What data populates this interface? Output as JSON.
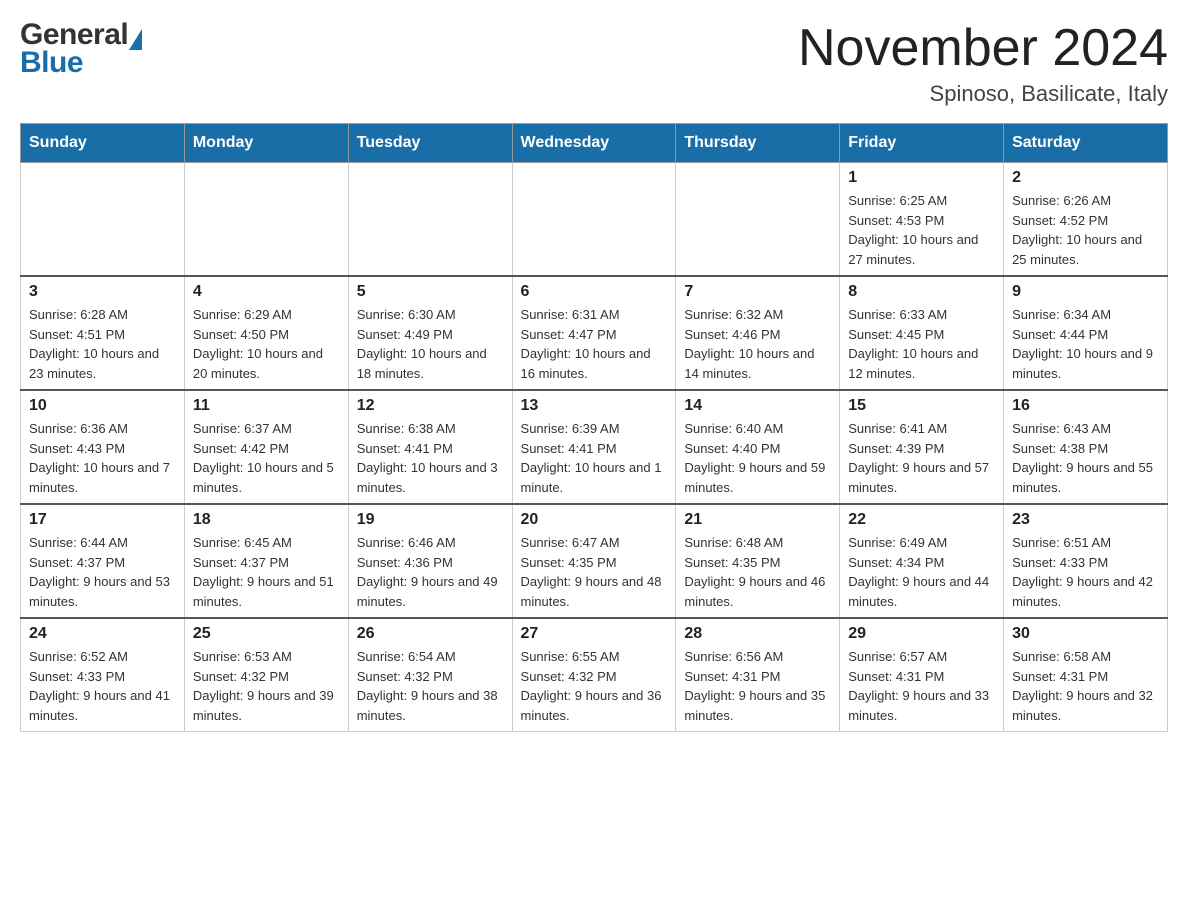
{
  "header": {
    "month_title": "November 2024",
    "subtitle": "Spinoso, Basilicate, Italy"
  },
  "days_of_week": [
    "Sunday",
    "Monday",
    "Tuesday",
    "Wednesday",
    "Thursday",
    "Friday",
    "Saturday"
  ],
  "weeks": [
    [
      {
        "day": "",
        "info": ""
      },
      {
        "day": "",
        "info": ""
      },
      {
        "day": "",
        "info": ""
      },
      {
        "day": "",
        "info": ""
      },
      {
        "day": "",
        "info": ""
      },
      {
        "day": "1",
        "info": "Sunrise: 6:25 AM\nSunset: 4:53 PM\nDaylight: 10 hours and 27 minutes."
      },
      {
        "day": "2",
        "info": "Sunrise: 6:26 AM\nSunset: 4:52 PM\nDaylight: 10 hours and 25 minutes."
      }
    ],
    [
      {
        "day": "3",
        "info": "Sunrise: 6:28 AM\nSunset: 4:51 PM\nDaylight: 10 hours and 23 minutes."
      },
      {
        "day": "4",
        "info": "Sunrise: 6:29 AM\nSunset: 4:50 PM\nDaylight: 10 hours and 20 minutes."
      },
      {
        "day": "5",
        "info": "Sunrise: 6:30 AM\nSunset: 4:49 PM\nDaylight: 10 hours and 18 minutes."
      },
      {
        "day": "6",
        "info": "Sunrise: 6:31 AM\nSunset: 4:47 PM\nDaylight: 10 hours and 16 minutes."
      },
      {
        "day": "7",
        "info": "Sunrise: 6:32 AM\nSunset: 4:46 PM\nDaylight: 10 hours and 14 minutes."
      },
      {
        "day": "8",
        "info": "Sunrise: 6:33 AM\nSunset: 4:45 PM\nDaylight: 10 hours and 12 minutes."
      },
      {
        "day": "9",
        "info": "Sunrise: 6:34 AM\nSunset: 4:44 PM\nDaylight: 10 hours and 9 minutes."
      }
    ],
    [
      {
        "day": "10",
        "info": "Sunrise: 6:36 AM\nSunset: 4:43 PM\nDaylight: 10 hours and 7 minutes."
      },
      {
        "day": "11",
        "info": "Sunrise: 6:37 AM\nSunset: 4:42 PM\nDaylight: 10 hours and 5 minutes."
      },
      {
        "day": "12",
        "info": "Sunrise: 6:38 AM\nSunset: 4:41 PM\nDaylight: 10 hours and 3 minutes."
      },
      {
        "day": "13",
        "info": "Sunrise: 6:39 AM\nSunset: 4:41 PM\nDaylight: 10 hours and 1 minute."
      },
      {
        "day": "14",
        "info": "Sunrise: 6:40 AM\nSunset: 4:40 PM\nDaylight: 9 hours and 59 minutes."
      },
      {
        "day": "15",
        "info": "Sunrise: 6:41 AM\nSunset: 4:39 PM\nDaylight: 9 hours and 57 minutes."
      },
      {
        "day": "16",
        "info": "Sunrise: 6:43 AM\nSunset: 4:38 PM\nDaylight: 9 hours and 55 minutes."
      }
    ],
    [
      {
        "day": "17",
        "info": "Sunrise: 6:44 AM\nSunset: 4:37 PM\nDaylight: 9 hours and 53 minutes."
      },
      {
        "day": "18",
        "info": "Sunrise: 6:45 AM\nSunset: 4:37 PM\nDaylight: 9 hours and 51 minutes."
      },
      {
        "day": "19",
        "info": "Sunrise: 6:46 AM\nSunset: 4:36 PM\nDaylight: 9 hours and 49 minutes."
      },
      {
        "day": "20",
        "info": "Sunrise: 6:47 AM\nSunset: 4:35 PM\nDaylight: 9 hours and 48 minutes."
      },
      {
        "day": "21",
        "info": "Sunrise: 6:48 AM\nSunset: 4:35 PM\nDaylight: 9 hours and 46 minutes."
      },
      {
        "day": "22",
        "info": "Sunrise: 6:49 AM\nSunset: 4:34 PM\nDaylight: 9 hours and 44 minutes."
      },
      {
        "day": "23",
        "info": "Sunrise: 6:51 AM\nSunset: 4:33 PM\nDaylight: 9 hours and 42 minutes."
      }
    ],
    [
      {
        "day": "24",
        "info": "Sunrise: 6:52 AM\nSunset: 4:33 PM\nDaylight: 9 hours and 41 minutes."
      },
      {
        "day": "25",
        "info": "Sunrise: 6:53 AM\nSunset: 4:32 PM\nDaylight: 9 hours and 39 minutes."
      },
      {
        "day": "26",
        "info": "Sunrise: 6:54 AM\nSunset: 4:32 PM\nDaylight: 9 hours and 38 minutes."
      },
      {
        "day": "27",
        "info": "Sunrise: 6:55 AM\nSunset: 4:32 PM\nDaylight: 9 hours and 36 minutes."
      },
      {
        "day": "28",
        "info": "Sunrise: 6:56 AM\nSunset: 4:31 PM\nDaylight: 9 hours and 35 minutes."
      },
      {
        "day": "29",
        "info": "Sunrise: 6:57 AM\nSunset: 4:31 PM\nDaylight: 9 hours and 33 minutes."
      },
      {
        "day": "30",
        "info": "Sunrise: 6:58 AM\nSunset: 4:31 PM\nDaylight: 9 hours and 32 minutes."
      }
    ]
  ]
}
